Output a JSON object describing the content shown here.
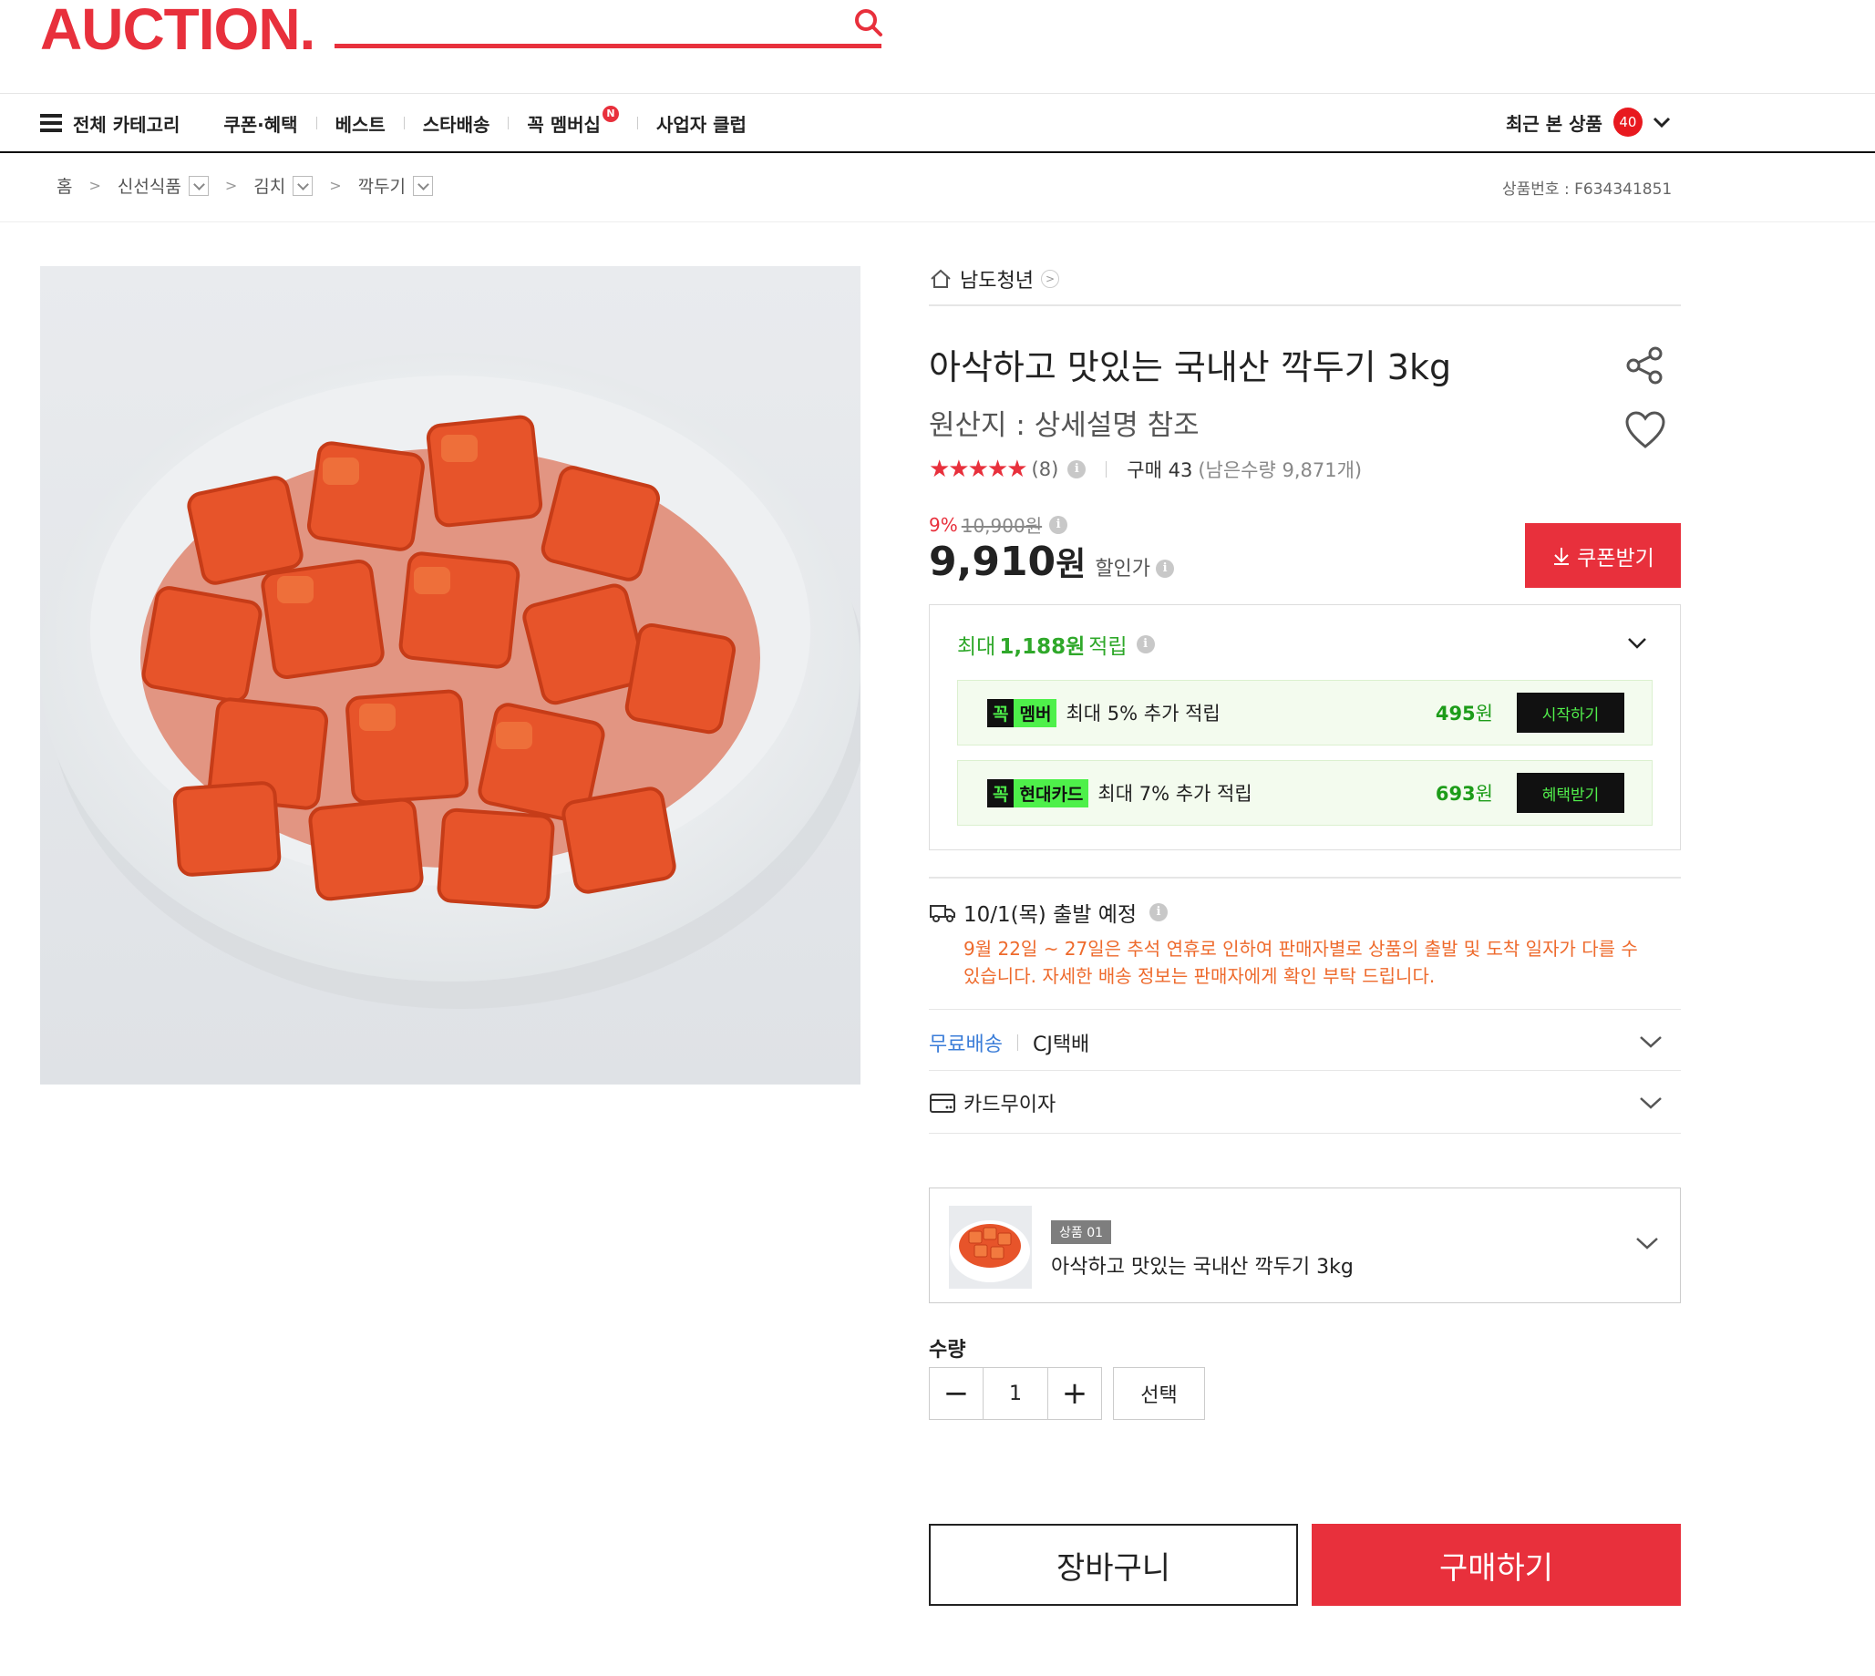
{
  "header": {
    "logo": "AUCTION."
  },
  "nav": {
    "all_categories": "전체 카테고리",
    "items": [
      "쿠폰·혜택",
      "베스트",
      "스타배송",
      "꼭 멤버십",
      "사업자 클럽"
    ],
    "membership_badge": "N",
    "recent": "최근 본 상품",
    "recent_count": "40"
  },
  "breadcrumb": {
    "home": "홈",
    "levels": [
      "신선식품",
      "김치",
      "깍두기"
    ],
    "product_no": "상품번호 : F634341851"
  },
  "product": {
    "seller": "남도청년",
    "title": "아삭하고 맛있는 국내산 깍두기 3kg",
    "origin": "원산지 : 상세설명 참조",
    "rating_stars": "★★★★★",
    "review_count": "(8)",
    "purchase": "구매 43",
    "stock": "(남은수량 9,871개)",
    "discount_rate": "9%",
    "original_price": "10,900원",
    "price": "9,910",
    "price_unit": "원",
    "price_label": "할인가",
    "coupon_button": "쿠폰받기"
  },
  "reward": {
    "prefix": "최대",
    "amount": "1,188원",
    "suffix": "적립",
    "rows": [
      {
        "tag_k": "꼭",
        "tag_n": "멤버",
        "desc": "최대 5% 추가 적립",
        "amount": "495",
        "unit": "원",
        "action": "시작하기"
      },
      {
        "tag_k": "꼭",
        "tag_n": "현대카드",
        "desc": "최대 7% 추가 적립",
        "amount": "693",
        "unit": "원",
        "action": "혜택받기"
      }
    ]
  },
  "shipping": {
    "departure": "10/1(목) 출발 예정",
    "notice": "9월 22일 ~ 27일은 추석 연휴로 인하여 판매자별로 상품의 출발 및 도착 일자가 다를 수 있습니다. 자세한 배송 정보는 판매자에게 확인 부탁 드립니다.",
    "free": "무료배송",
    "carrier": "CJ택배",
    "card": "카드무이자"
  },
  "option": {
    "tag": "상품 01",
    "name": "아삭하고 맛있는 국내산 깍두기 3kg"
  },
  "quantity": {
    "label": "수량",
    "minus": "−",
    "value": "1",
    "plus": "+",
    "select": "선택"
  },
  "actions": {
    "cart": "장바구니",
    "buy": "구매하기"
  },
  "colors": {
    "brand": "#e8303c",
    "reward_green": "#2fa82a",
    "notice_orange": "#ee6a2c",
    "free_blue": "#3b7dd8"
  }
}
